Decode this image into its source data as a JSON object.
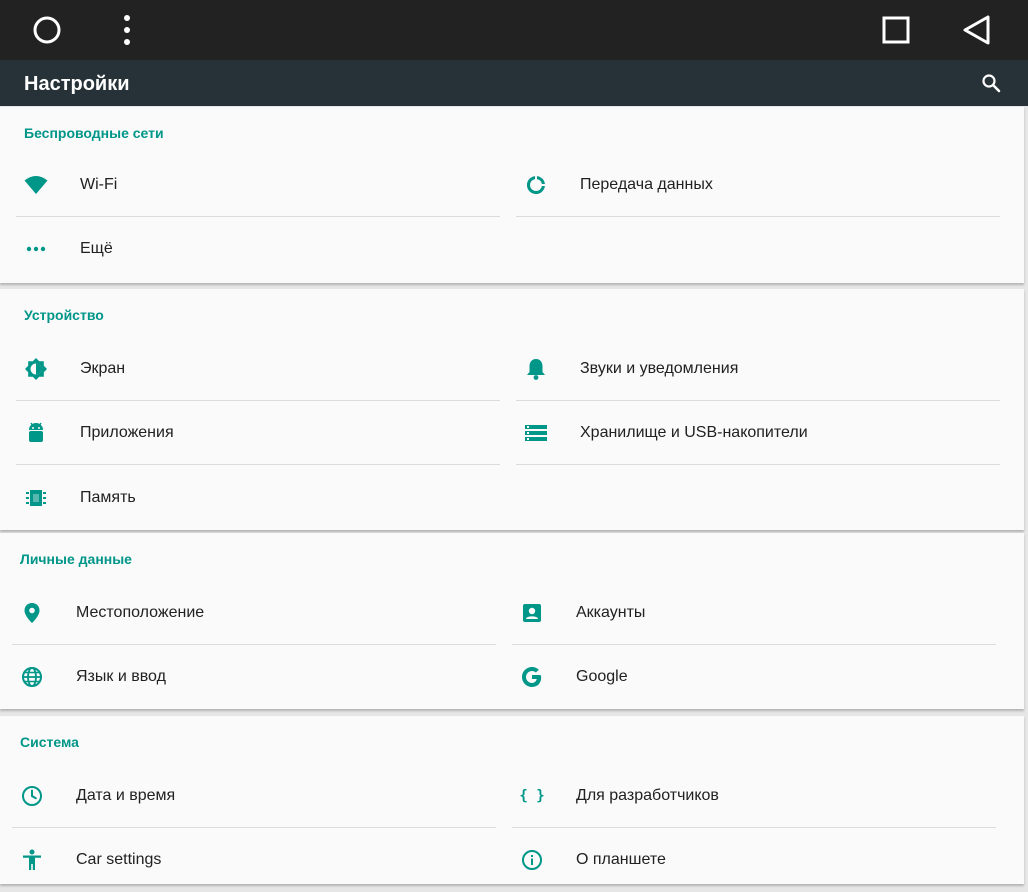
{
  "navbar": {
    "home_icon": "circle-home-icon",
    "menu_icon": "overflow-menu-icon",
    "recents_icon": "square-recents-icon",
    "back_icon": "triangle-back-icon"
  },
  "appbar": {
    "title": "Настройки",
    "search_icon": "search-icon"
  },
  "colors": {
    "accent": "#009688",
    "appbar": "#263238",
    "navbar": "#222222",
    "card": "#fbfafb"
  },
  "sections": {
    "wireless": {
      "header": "Беспроводные сети",
      "items": [
        {
          "label": "Wi-Fi",
          "icon": "wifi-icon"
        },
        {
          "label": "Передача данных",
          "icon": "data-usage-icon"
        },
        {
          "label": "Ещё",
          "icon": "more-dots-icon"
        }
      ]
    },
    "device": {
      "header": "Устройство",
      "items": [
        {
          "label": "Экран",
          "icon": "brightness-icon"
        },
        {
          "label": "Звуки и уведомления",
          "icon": "bell-icon"
        },
        {
          "label": "Приложения",
          "icon": "android-icon"
        },
        {
          "label": "Хранилище и USB-накопители",
          "icon": "storage-icon"
        },
        {
          "label": "Память",
          "icon": "memory-chip-icon"
        }
      ]
    },
    "personal": {
      "header": "Личные данные",
      "items": [
        {
          "label": "Местоположение",
          "icon": "location-pin-icon"
        },
        {
          "label": "Аккаунты",
          "icon": "account-box-icon"
        },
        {
          "label": "Язык и ввод",
          "icon": "globe-icon"
        },
        {
          "label": "Google",
          "icon": "google-icon"
        }
      ]
    },
    "system": {
      "header": "Система",
      "items": [
        {
          "label": "Дата и время",
          "icon": "clock-icon"
        },
        {
          "label": "Для разработчиков",
          "icon": "code-braces-icon"
        },
        {
          "label": "Car settings",
          "icon": "accessibility-icon"
        },
        {
          "label": "О планшете",
          "icon": "info-icon"
        }
      ]
    }
  }
}
